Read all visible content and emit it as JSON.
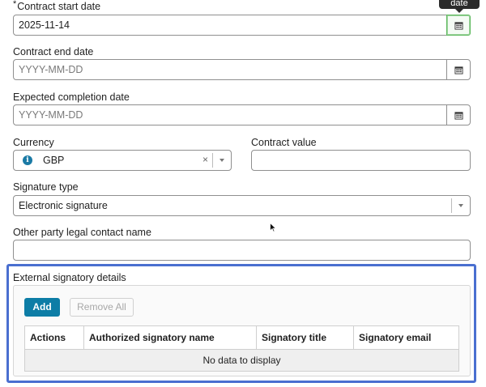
{
  "contract_start": {
    "label": "Contract start date",
    "required_marker": "*",
    "value": "2025-11-14",
    "tooltip": "date"
  },
  "contract_end": {
    "label": "Contract end date",
    "placeholder": "YYYY-MM-DD"
  },
  "expected_completion": {
    "label": "Expected completion date",
    "placeholder": "YYYY-MM-DD"
  },
  "currency": {
    "label": "Currency",
    "info_icon": "i",
    "value": "GBP",
    "clear": "×"
  },
  "contract_value": {
    "label": "Contract value",
    "value": ""
  },
  "signature_type": {
    "label": "Signature type",
    "value": "Electronic signature"
  },
  "other_party": {
    "label": "Other party legal contact name",
    "value": ""
  },
  "external_signatory": {
    "title": "External signatory details",
    "add_label": "Add",
    "remove_all_label": "Remove All",
    "columns": [
      "Actions",
      "Authorized signatory name",
      "Signatory title",
      "Signatory email"
    ],
    "empty_message": "No data to display"
  },
  "icons": {
    "calendar": "calendar-icon",
    "info": "info-icon",
    "dropdown": "chevron-down-icon",
    "cursor": "mouse-cursor-icon"
  },
  "colors": {
    "primary": "#0d7da6",
    "highlight": "#4a6fd0",
    "active_border": "#5cb85c"
  }
}
